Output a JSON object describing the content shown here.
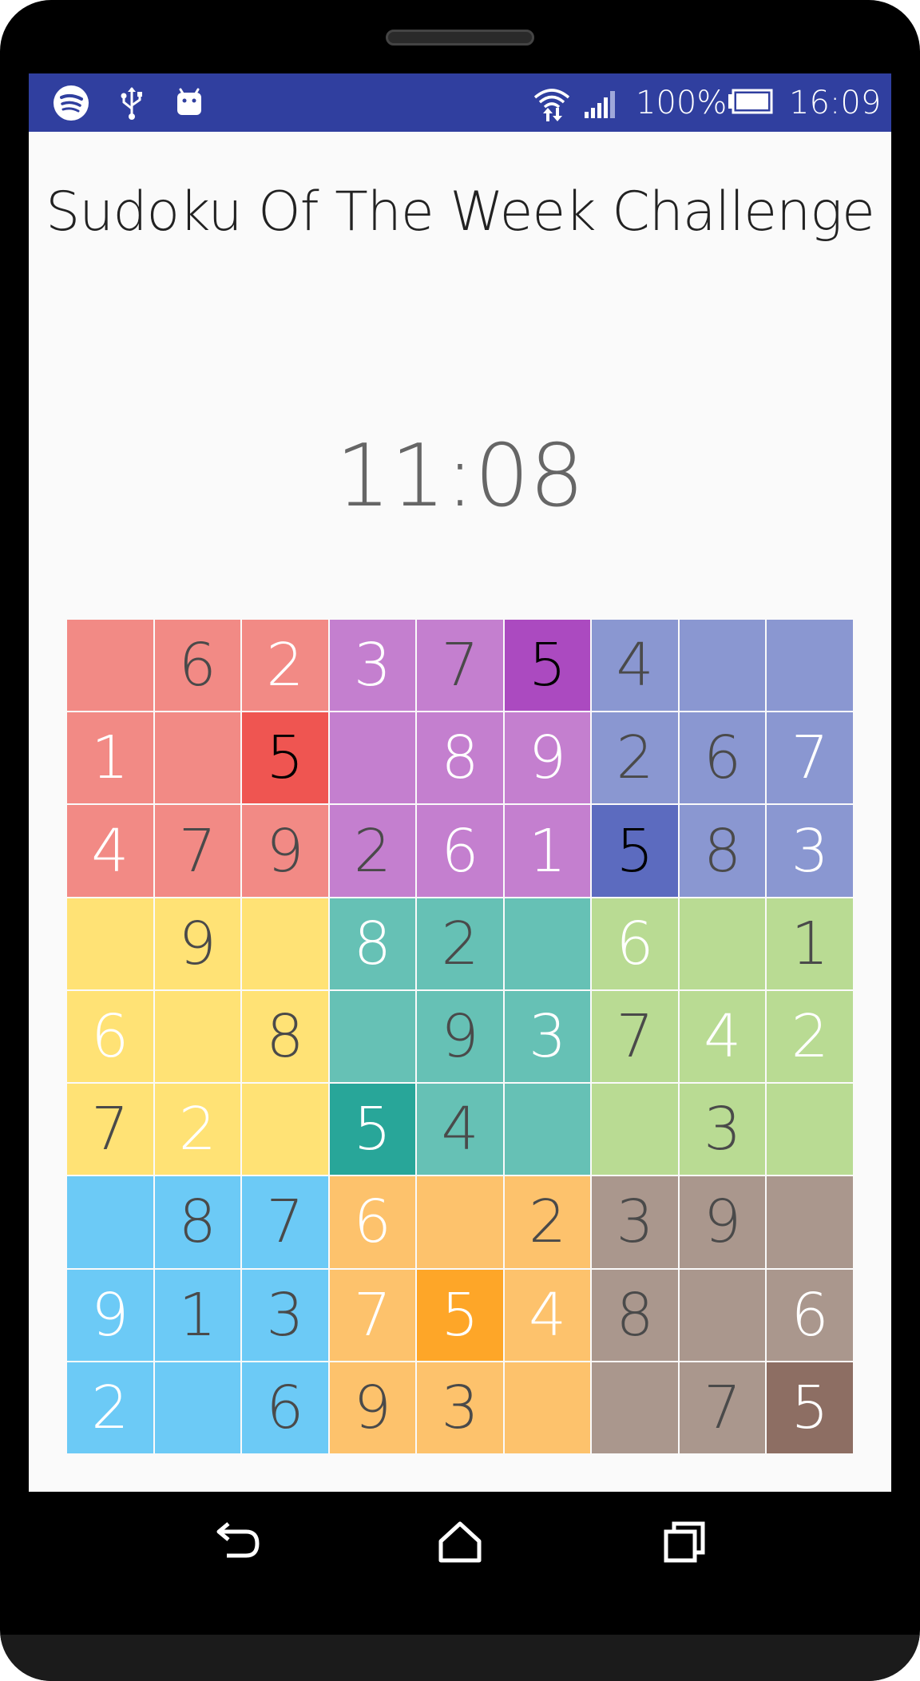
{
  "status_bar": {
    "battery": "100%",
    "time": "16:09",
    "icons": [
      "spotify-icon",
      "usb-icon",
      "android-icon",
      "wifi-icon",
      "signal-icon",
      "battery-icon"
    ]
  },
  "title": "Sudoku Of The Week Challenge",
  "timer": "11:08",
  "board": {
    "values": [
      [
        "",
        "6",
        "2",
        "3",
        "7",
        "5",
        "4",
        "",
        ""
      ],
      [
        "1",
        "",
        "5",
        "",
        "8",
        "9",
        "2",
        "6",
        "7"
      ],
      [
        "4",
        "7",
        "9",
        "2",
        "6",
        "1",
        "5",
        "8",
        "3"
      ],
      [
        "",
        "9",
        "",
        "8",
        "2",
        "",
        "6",
        "",
        "1"
      ],
      [
        "6",
        "",
        "8",
        "",
        "9",
        "3",
        "7",
        "4",
        "2"
      ],
      [
        "7",
        "2",
        "",
        "5",
        "4",
        "",
        "",
        "3",
        ""
      ],
      [
        "",
        "8",
        "7",
        "6",
        "",
        "2",
        "3",
        "9",
        ""
      ],
      [
        "9",
        "1",
        "3",
        "7",
        "5",
        "4",
        "8",
        "",
        "6"
      ],
      [
        "2",
        "",
        "6",
        "9",
        "3",
        "",
        "",
        "7",
        "5"
      ]
    ],
    "text_styles": [
      [
        "",
        "n",
        "l",
        "l",
        "n",
        "d",
        "n",
        "",
        ""
      ],
      [
        "l",
        "",
        "d",
        "",
        "l",
        "l",
        "n",
        "n",
        "l"
      ],
      [
        "l",
        "n",
        "n",
        "n",
        "l",
        "l",
        "d",
        "n",
        "l"
      ],
      [
        "",
        "n",
        "",
        "l",
        "n",
        "",
        "l",
        "",
        "n"
      ],
      [
        "l",
        "",
        "n",
        "",
        "n",
        "l",
        "n",
        "l",
        "l"
      ],
      [
        "n",
        "l",
        "",
        "l",
        "n",
        "",
        "",
        "n",
        ""
      ],
      [
        "",
        "n",
        "n",
        "l",
        "",
        "n",
        "n",
        "n",
        ""
      ],
      [
        "l",
        "n",
        "n",
        "l",
        "l",
        "l",
        "n",
        "",
        "l"
      ],
      [
        "l",
        "",
        "n",
        "n",
        "n",
        "",
        "",
        "n",
        "l"
      ]
    ],
    "box_colors": [
      [
        "#f28a85",
        "#c47fcf",
        "#8a97d1"
      ],
      [
        "#ffe275",
        "#66c1b5",
        "#b9db93"
      ],
      [
        "#6ccaf6",
        "#fdc26c",
        "#aa978d"
      ]
    ],
    "highlights": [
      {
        "row": 0,
        "col": 5,
        "color": "#ab4ac0"
      },
      {
        "row": 1,
        "col": 2,
        "color": "#ef5551"
      },
      {
        "row": 2,
        "col": 6,
        "color": "#5c6bbf"
      },
      {
        "row": 5,
        "col": 3,
        "color": "#28a699"
      },
      {
        "row": 7,
        "col": 4,
        "color": "#fea628"
      },
      {
        "row": 8,
        "col": 8,
        "color": "#8d6e63"
      }
    ]
  },
  "nav": {
    "buttons": [
      "back-button",
      "home-button",
      "recents-button"
    ]
  }
}
